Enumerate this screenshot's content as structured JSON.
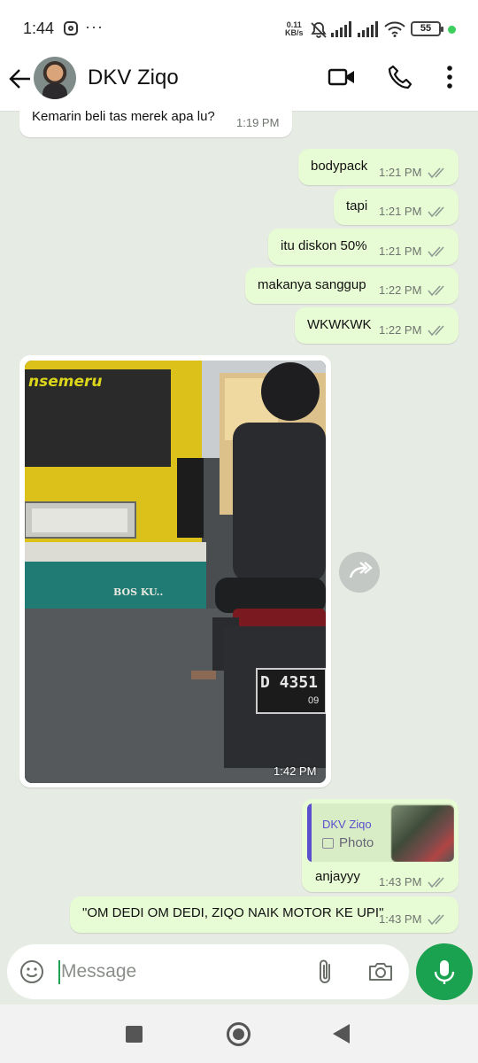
{
  "status_bar": {
    "time": "1:44",
    "net_speed_value": "0.11",
    "net_speed_unit": "KB/s",
    "battery": "55",
    "icons": [
      "instagram-icon",
      "more-dots-icon",
      "mute-icon",
      "signal-icon",
      "signal-icon",
      "wifi-icon",
      "battery-icon"
    ]
  },
  "header": {
    "contact_name": "DKV Ziqo",
    "icons": [
      "back-arrow-icon",
      "video-call-icon",
      "voice-call-icon",
      "menu-dots-icon"
    ]
  },
  "messages": [
    {
      "direction": "in",
      "text": "Kemarin beli tas merek apa lu?",
      "time": "1:19 PM"
    },
    {
      "direction": "out",
      "text": "bodypack",
      "time": "1:21 PM",
      "status": "delivered"
    },
    {
      "direction": "out",
      "text": "tapi",
      "time": "1:21 PM",
      "status": "delivered"
    },
    {
      "direction": "out",
      "text": "itu diskon 50%",
      "time": "1:21 PM",
      "status": "delivered"
    },
    {
      "direction": "out",
      "text": "makanya sanggup",
      "time": "1:22 PM",
      "status": "delivered"
    },
    {
      "direction": "out",
      "text": "WKWKWK",
      "time": "1:22 PM",
      "status": "delivered"
    },
    {
      "direction": "in",
      "type": "photo",
      "time": "1:42 PM",
      "photo_text": {
        "van_sign": "nsemeru",
        "van_side": "BOS KU..",
        "plate_moto": "D 4351",
        "plate_sub": "09"
      }
    },
    {
      "direction": "out",
      "quote": {
        "author": "DKV Ziqo",
        "type": "Photo"
      },
      "text": "anjayyy",
      "time": "1:43 PM",
      "status": "delivered"
    },
    {
      "direction": "out",
      "text": "\"OM DEDI OM DEDI, ZIQO NAIK MOTOR KE UPI\"",
      "time": "1:43 PM",
      "status": "delivered"
    }
  ],
  "input": {
    "placeholder": "Message"
  },
  "colors": {
    "accent": "#1aa251",
    "outgoing_bubble": "#e7fbd4",
    "chat_background": "#e6ebe3",
    "quote_author": "#5b4ecf",
    "ticks": "#8e9a93"
  }
}
